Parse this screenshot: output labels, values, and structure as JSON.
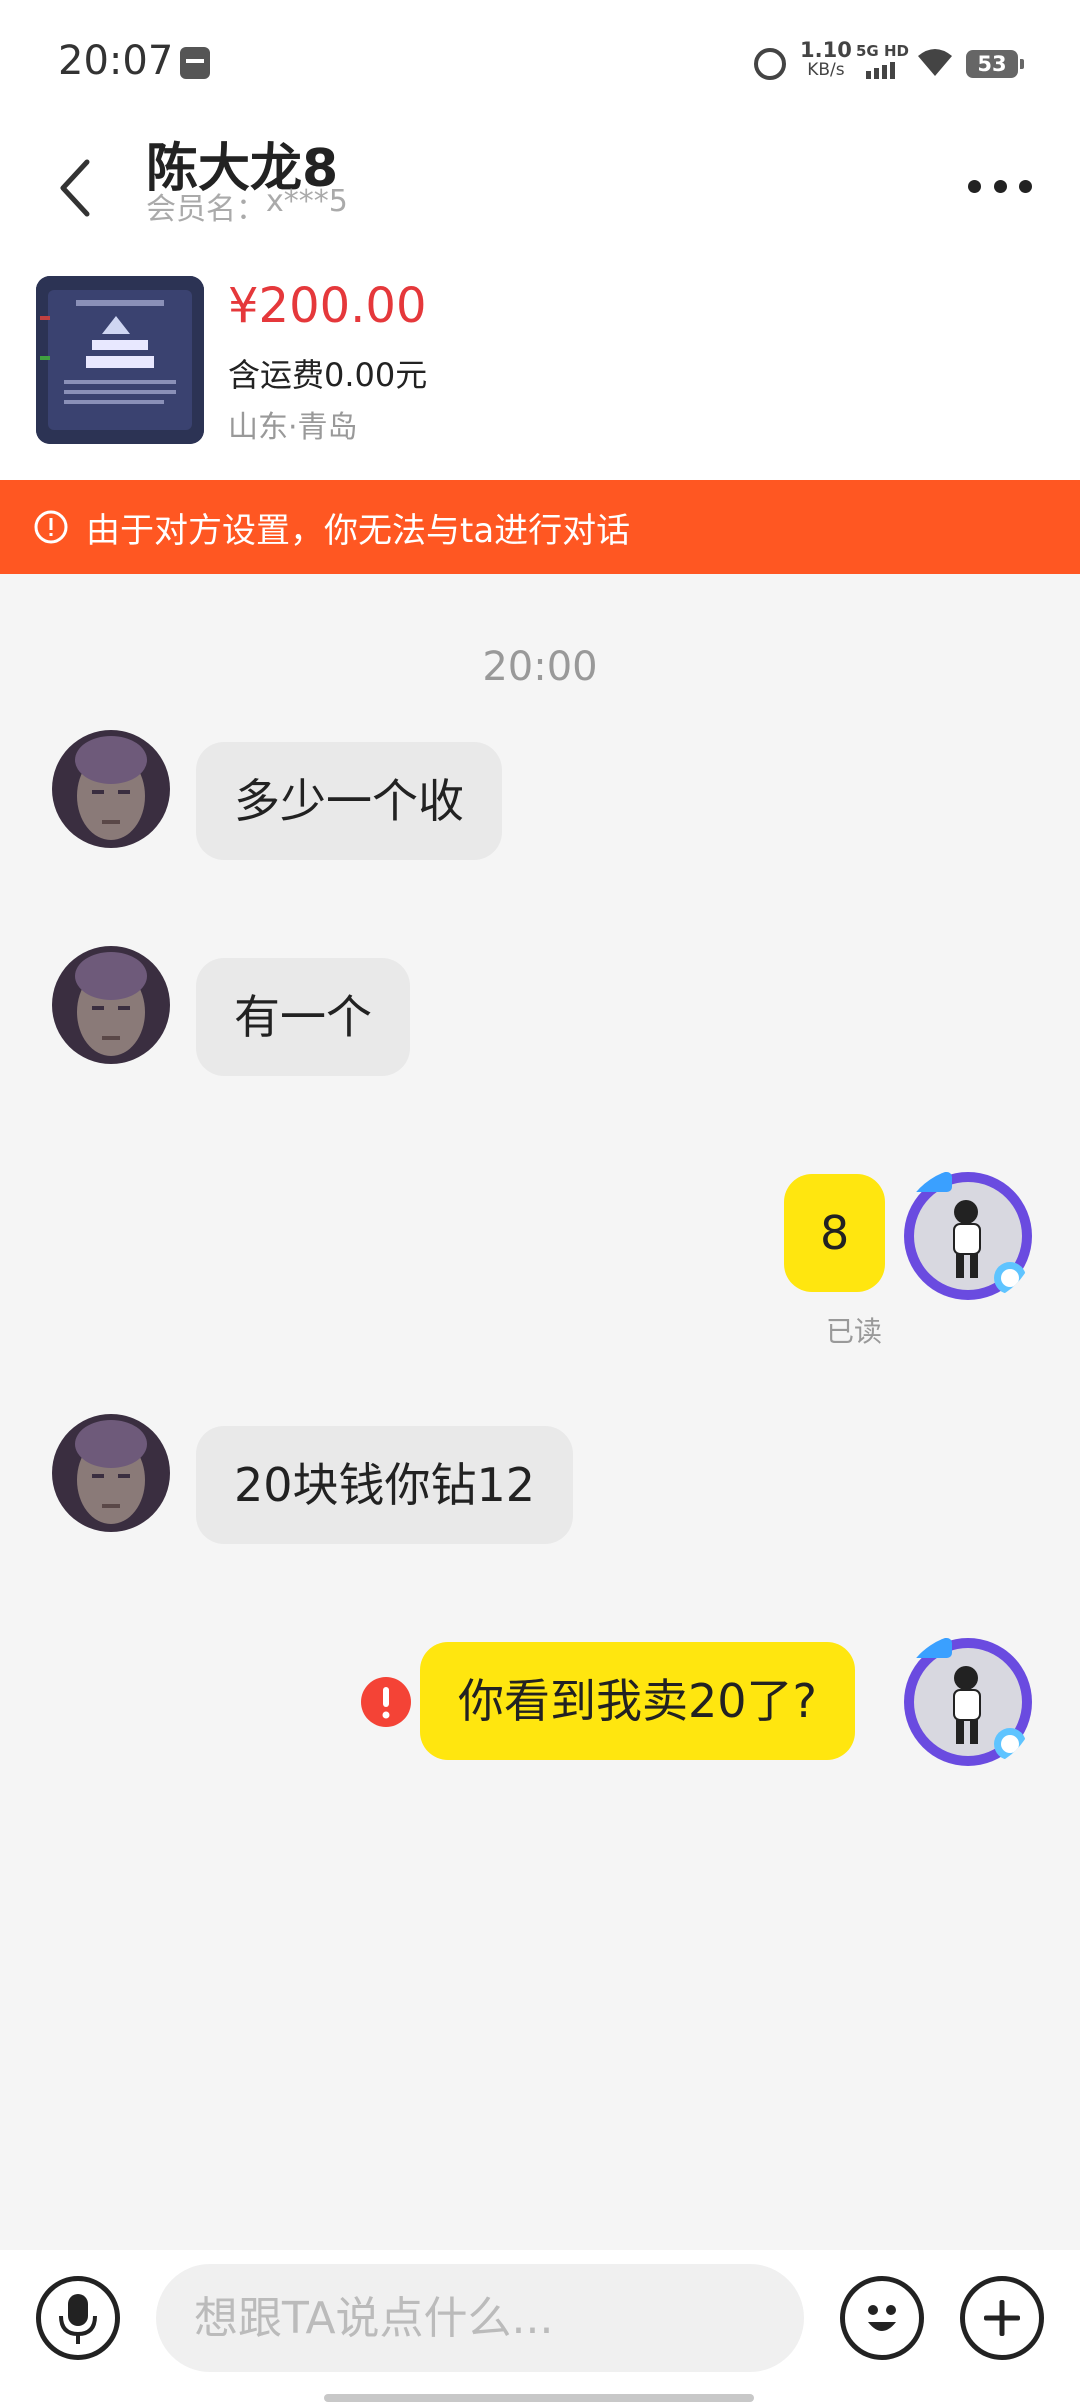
{
  "status_bar": {
    "time": "20:07",
    "net_speed": "1.10",
    "net_speed_unit": "KB/s",
    "network": "5G HD",
    "battery": "53"
  },
  "header": {
    "name": "陈大龙8",
    "member_label": "会员名：",
    "member_id": "x***5"
  },
  "product": {
    "price": "¥200.00",
    "shipping": "含运费0.00元",
    "location": "山东·青岛"
  },
  "warning": {
    "text": "由于对方设置，你无法与ta进行对话"
  },
  "chat": {
    "timestamp": "20:00",
    "messages": [
      {
        "from": "other",
        "text": "多少一个收"
      },
      {
        "from": "other",
        "text": "有一个"
      },
      {
        "from": "me",
        "text": "8",
        "status": "已读"
      },
      {
        "from": "other",
        "text": "20块钱你钻12"
      },
      {
        "from": "me",
        "text": "你看到我卖20了?",
        "failed": true
      }
    ]
  },
  "input": {
    "placeholder": "想跟TA说点什么..."
  },
  "colors": {
    "warning_bg": "#ff5722",
    "price": "#e5383b",
    "my_bubble": "#ffe60f",
    "other_bubble": "#e9e9e9",
    "error": "#f44336"
  },
  "icons": [
    "back-icon",
    "more-icon",
    "alert-circle-icon",
    "error-icon",
    "microphone-icon",
    "emoji-icon",
    "plus-icon"
  ]
}
